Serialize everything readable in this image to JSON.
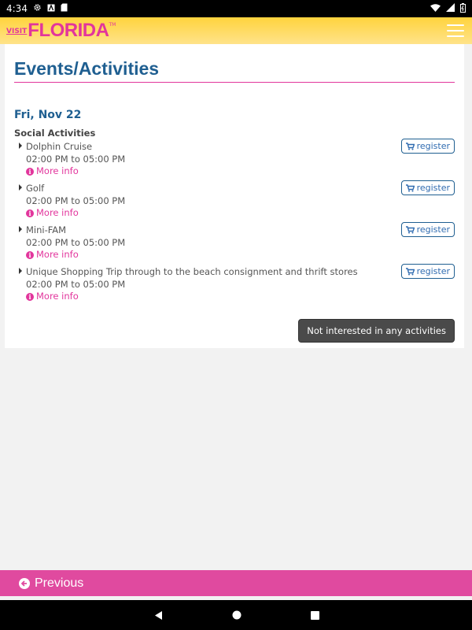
{
  "status_bar": {
    "time": "4:34"
  },
  "header": {
    "logo_visit": "VISIT",
    "logo_florida": "FLORIDA",
    "logo_tm": "TM"
  },
  "page": {
    "title": "Events/Activities",
    "date": "Fri, Nov 22",
    "section": "Social Activities"
  },
  "activities": [
    {
      "name": "Dolphin Cruise",
      "time": "02:00 PM to 05:00 PM",
      "more_info": "More info",
      "register": "register"
    },
    {
      "name": "Golf",
      "time": "02:00 PM to 05:00 PM",
      "more_info": "More info",
      "register": "register"
    },
    {
      "name": "Mini-FAM",
      "time": "02:00 PM to 05:00 PM",
      "more_info": "More info",
      "register": "register"
    },
    {
      "name": "Unique Shopping Trip through to the beach consignment and thrift stores",
      "time": "02:00 PM to 05:00 PM",
      "more_info": "More info",
      "register": "register"
    }
  ],
  "actions": {
    "not_interested": "Not interested in any activities"
  },
  "footer": {
    "previous": "Previous"
  },
  "colors": {
    "brand_pink": "#e2359c",
    "title_blue": "#1f5f91",
    "header_yellow": "#ffd33d"
  }
}
